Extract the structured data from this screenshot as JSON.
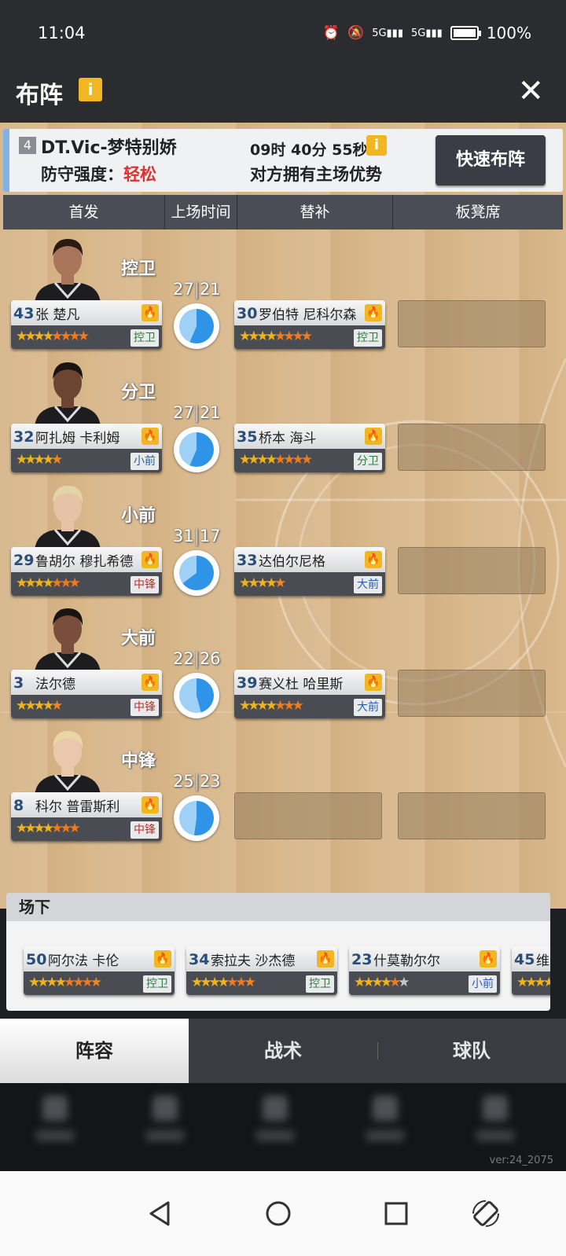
{
  "status_bar": {
    "time": "11:04",
    "network": "5G",
    "battery": "100%"
  },
  "header": {
    "title": "布阵",
    "info_label": "i",
    "close_label": "✕"
  },
  "match": {
    "round": "4",
    "opponent": "DT.Vic-梦特别娇",
    "defense_label": "防守强度：",
    "defense_value": "轻松",
    "countdown": "09时 40分 55秒",
    "info_label": "i",
    "home_advantage": "对方拥有主场优势",
    "quick_button": "快速布阵"
  },
  "columns": {
    "starter": "首发",
    "time": "上场时间",
    "substitute": "替补",
    "bench": "板凳席"
  },
  "rows": [
    {
      "position": "控卫",
      "starter": {
        "number": "43",
        "name": "张 楚凡",
        "pos": "控卫",
        "stars_full": 4,
        "stars_half": 3,
        "last": "half"
      },
      "time": {
        "starter": "27",
        "sub": "21"
      },
      "sub": {
        "number": "30",
        "name": "罗伯特 尼科尔森",
        "pos": "控卫",
        "stars_full": 4,
        "stars_half": 3,
        "last": "half"
      }
    },
    {
      "position": "分卫",
      "starter": {
        "number": "32",
        "name": "阿扎姆 卡利姆",
        "pos": "小前",
        "stars_full": 4,
        "stars_half": 0,
        "last": "orange"
      },
      "time": {
        "starter": "27",
        "sub": "21"
      },
      "sub": {
        "number": "35",
        "name": "桥本 海斗",
        "pos": "分卫",
        "stars_full": 4,
        "stars_half": 3,
        "last": "half"
      }
    },
    {
      "position": "小前",
      "starter": {
        "number": "29",
        "name": "鲁胡尔 穆扎希德",
        "pos": "中锋",
        "stars_full": 4,
        "stars_half": 2,
        "last": "half"
      },
      "time": {
        "starter": "31",
        "sub": "17"
      },
      "sub": {
        "number": "33",
        "name": "达伯尔尼格",
        "pos": "大前",
        "stars_full": 4,
        "stars_half": 0,
        "last": "orange"
      }
    },
    {
      "position": "大前",
      "starter": {
        "number": "3",
        "name": "法尔德",
        "pos": "中锋",
        "stars_full": 4,
        "stars_half": 0,
        "last": "orange"
      },
      "time": {
        "starter": "22",
        "sub": "26"
      },
      "sub": {
        "number": "39",
        "name": "赛义杜 哈里斯",
        "pos": "大前",
        "stars_full": 4,
        "stars_half": 2,
        "last": "half"
      }
    },
    {
      "position": "中锋",
      "starter": {
        "number": "8",
        "name": "科尔 普雷斯利",
        "pos": "中锋",
        "stars_full": 4,
        "stars_half": 2,
        "last": "half"
      },
      "time": {
        "starter": "25",
        "sub": "23"
      },
      "sub": null
    }
  ],
  "offcourt": {
    "title": "场下",
    "players": [
      {
        "number": "50",
        "name": "阿尔法 卡伦",
        "pos": "控卫",
        "stars_full": 4,
        "stars_half": 3,
        "last": "orange"
      },
      {
        "number": "34",
        "name": "索拉夫 沙杰德",
        "pos": "控卫",
        "stars_full": 4,
        "stars_half": 2,
        "last": "orange"
      },
      {
        "number": "23",
        "name": "什莫勒尔尔",
        "pos": "小前",
        "stars_full": 4,
        "stars_half": 1,
        "last": "grey"
      },
      {
        "number": "45",
        "name": "维",
        "pos": "",
        "stars_full": 4,
        "stars_half": 0,
        "last": "none"
      }
    ]
  },
  "tabs": [
    "阵容",
    "战术",
    "球队"
  ],
  "version": "ver:24_2075"
}
